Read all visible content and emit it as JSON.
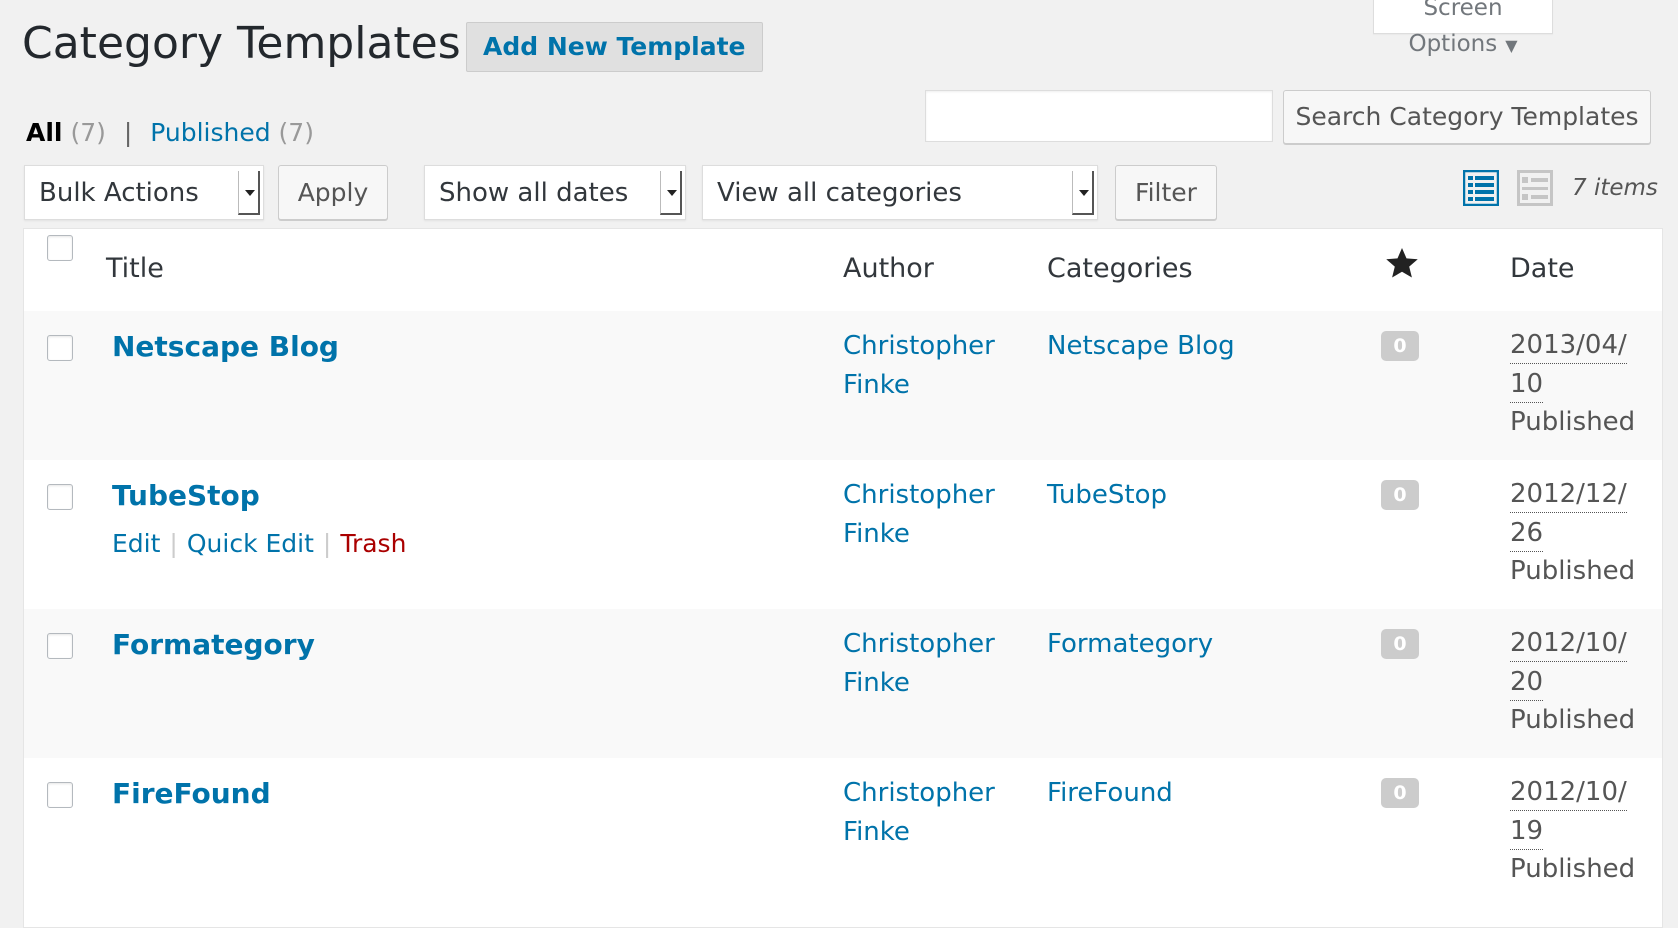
{
  "screen_options": {
    "label": "Screen Options"
  },
  "page": {
    "title": "Category Templates",
    "add_new_label": "Add New Template"
  },
  "filters": {
    "all_label": "All",
    "all_count": "(7)",
    "separator": "|",
    "published_label": "Published",
    "published_count": "(7)"
  },
  "search": {
    "value": "",
    "button_label": "Search Category Templates"
  },
  "toolbar": {
    "bulk_actions": "Bulk Actions",
    "apply_label": "Apply",
    "dates_filter": "Show all dates",
    "categories_filter": "View all categories",
    "filter_label": "Filter",
    "items_count": "7 items"
  },
  "table": {
    "headers": {
      "title": "Title",
      "author": "Author",
      "categories": "Categories",
      "date": "Date"
    },
    "rows": [
      {
        "title": "Netscape Blog",
        "author_first": "Christopher",
        "author_last": "Finke",
        "category": "Netscape Blog",
        "comments": "0",
        "date_part1": "2013/04/",
        "date_part2": "10",
        "status": "Published"
      },
      {
        "title": "TubeStop",
        "author_first": "Christopher",
        "author_last": "Finke",
        "category": "TubeStop",
        "comments": "0",
        "date_part1": "2012/12/",
        "date_part2": "26",
        "status": "Published"
      },
      {
        "title": "Formategory",
        "author_first": "Christopher",
        "author_last": "Finke",
        "category": "Formategory",
        "comments": "0",
        "date_part1": "2012/10/",
        "date_part2": "20",
        "status": "Published"
      },
      {
        "title": "FireFound",
        "author_first": "Christopher",
        "author_last": "Finke",
        "category": "FireFound",
        "comments": "0",
        "date_part1": "2012/10/",
        "date_part2": "19",
        "status": "Published"
      }
    ],
    "row_actions": {
      "edit": "Edit",
      "quick_edit": "Quick Edit",
      "trash": "Trash",
      "separator": "|"
    }
  },
  "colors": {
    "link": "#0073aa",
    "trash": "#a00",
    "badge": "#ccc",
    "view_active": "#0073aa"
  }
}
